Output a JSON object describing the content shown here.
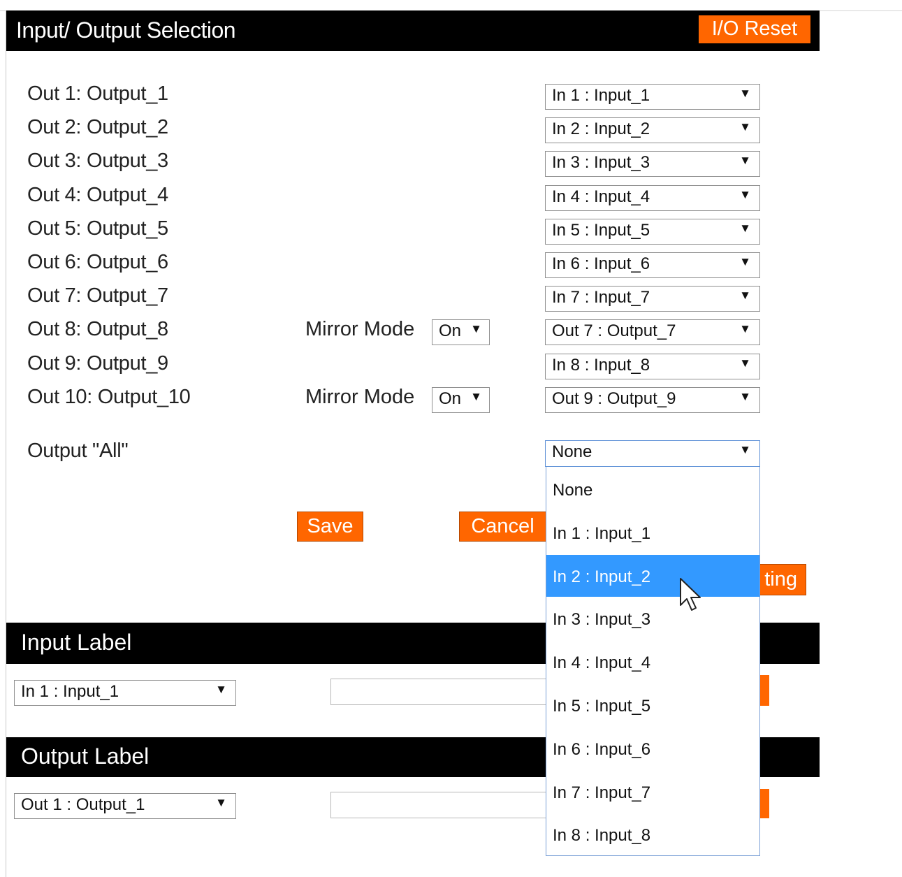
{
  "io_section": {
    "title": "Input/ Output Selection",
    "reset_label": "I/O Reset"
  },
  "routes": [
    {
      "output": "Out 1: Output_1",
      "input": "In 1 : Input_1"
    },
    {
      "output": "Out 2: Output_2",
      "input": "In 2 : Input_2"
    },
    {
      "output": "Out 3: Output_3",
      "input": "In 3 : Input_3"
    },
    {
      "output": "Out 4: Output_4",
      "input": "In 4 : Input_4"
    },
    {
      "output": "Out 5: Output_5",
      "input": "In 5 : Input_5"
    },
    {
      "output": "Out 6: Output_6",
      "input": "In 6 : Input_6"
    },
    {
      "output": "Out 7: Output_7",
      "input": "In 7 : Input_7"
    },
    {
      "output": "Out 8: Output_8",
      "input": "Out 7 : Output_7",
      "mirror_label": "Mirror Mode",
      "mirror_value": "On"
    },
    {
      "output": "Out 9: Output_9",
      "input": "In 8 : Input_8"
    },
    {
      "output": "Out 10: Output_10",
      "input": "Out 9 : Output_9",
      "mirror_label": "Mirror Mode",
      "mirror_value": "On"
    }
  ],
  "output_all": {
    "label": "Output \"All\"",
    "value": "None",
    "options": [
      "None",
      "In 1 : Input_1",
      "In 2 : Input_2",
      "In 3 : Input_3",
      "In 4 : Input_4",
      "In 5 : Input_5",
      "In 6 : Input_6",
      "In 7 : Input_7",
      "In 8 : Input_8"
    ],
    "highlighted_option": "In 2 : Input_2"
  },
  "actions": {
    "save_label": "Save",
    "cancel_label": "Cancel",
    "routing_label_visible": "ting"
  },
  "input_label_section": {
    "title": "Input Label",
    "select_value": "In 1 : Input_1",
    "field_value": ""
  },
  "output_label_section": {
    "title": "Output Label",
    "select_value": "Out 1 : Output_1",
    "field_value": ""
  },
  "colors": {
    "accent": "#ff6600",
    "bar": "#000000",
    "highlight": "#3399ff"
  },
  "icons": {
    "dropdown_arrow": "▼"
  }
}
